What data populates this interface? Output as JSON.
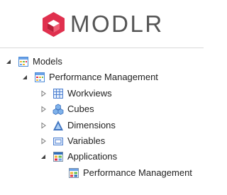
{
  "brand": {
    "name": "MODLR",
    "logo_icon": "modlr-logo-icon",
    "accent_color": "#e0304e"
  },
  "tree": {
    "root": {
      "label": "Models",
      "expanded": true,
      "icon": "models-icon"
    },
    "model": {
      "label": "Performance Management",
      "expanded": true,
      "icon": "model-icon"
    },
    "children": [
      {
        "label": "Workviews",
        "expanded": false,
        "icon": "workviews-icon"
      },
      {
        "label": "Cubes",
        "expanded": false,
        "icon": "cubes-icon"
      },
      {
        "label": "Dimensions",
        "expanded": false,
        "icon": "dimensions-icon"
      },
      {
        "label": "Variables",
        "expanded": false,
        "icon": "variables-icon"
      },
      {
        "label": "Applications",
        "expanded": true,
        "icon": "applications-icon"
      }
    ],
    "application": {
      "label": "Performance Management",
      "icon": "application-icon"
    }
  }
}
